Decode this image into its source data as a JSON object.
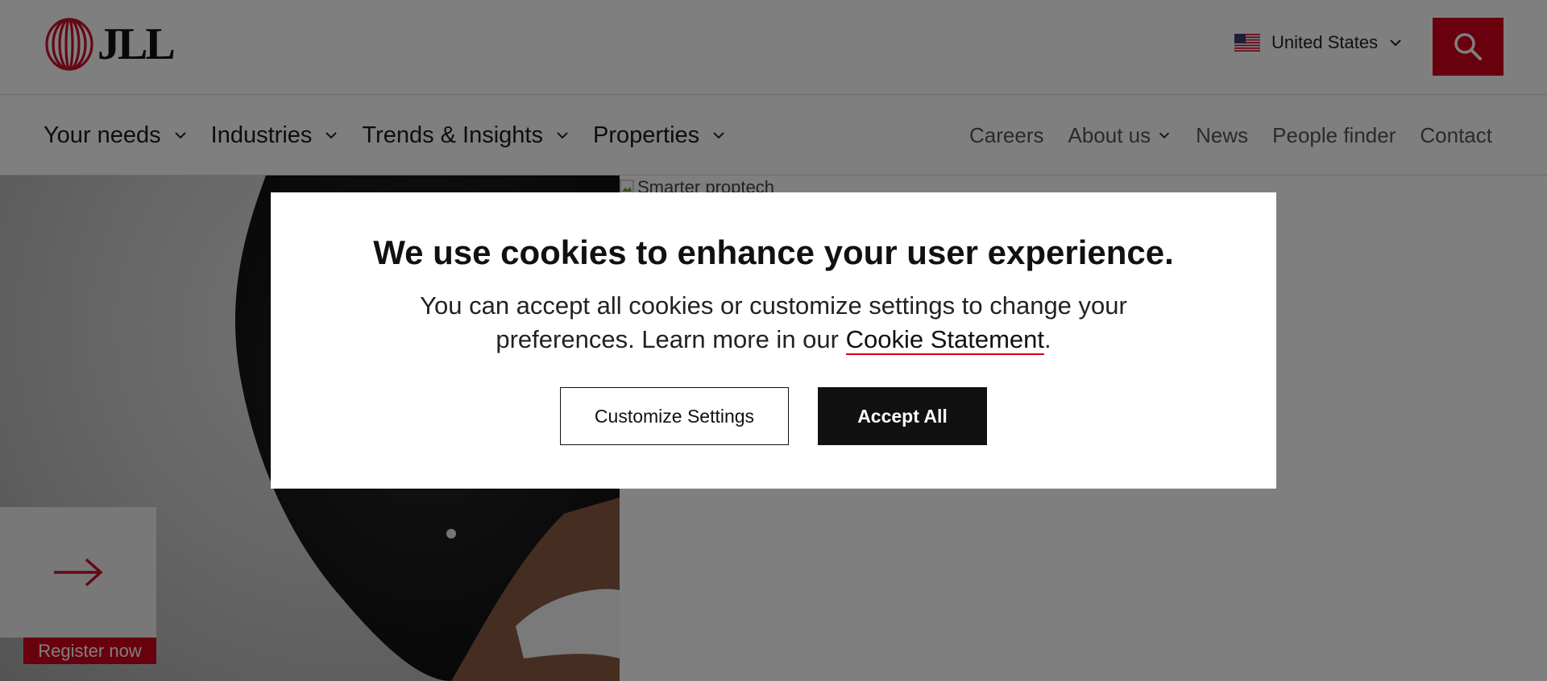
{
  "brand": {
    "logo_text": "JLL",
    "accent": "#d0021b"
  },
  "header": {
    "region_label": "United States",
    "search_icon": "search-icon"
  },
  "nav": {
    "primary": [
      {
        "label": "Your needs"
      },
      {
        "label": "Industries"
      },
      {
        "label": "Trends & Insights"
      },
      {
        "label": "Properties"
      }
    ],
    "secondary": {
      "careers": "Careers",
      "about": "About us",
      "news": "News",
      "people": "People finder",
      "contact": "Contact"
    }
  },
  "hero": {
    "image_alt": "Smarter proptech",
    "cta_label": "Register now"
  },
  "cookie_modal": {
    "title": "We use cookies to enhance your user experience.",
    "text_before": "You can accept all cookies or customize settings to change your preferences. Learn more in our ",
    "link_label": "Cookie Statement",
    "text_after": ".",
    "customize_label": "Customize Settings",
    "accept_label": "Accept All"
  }
}
